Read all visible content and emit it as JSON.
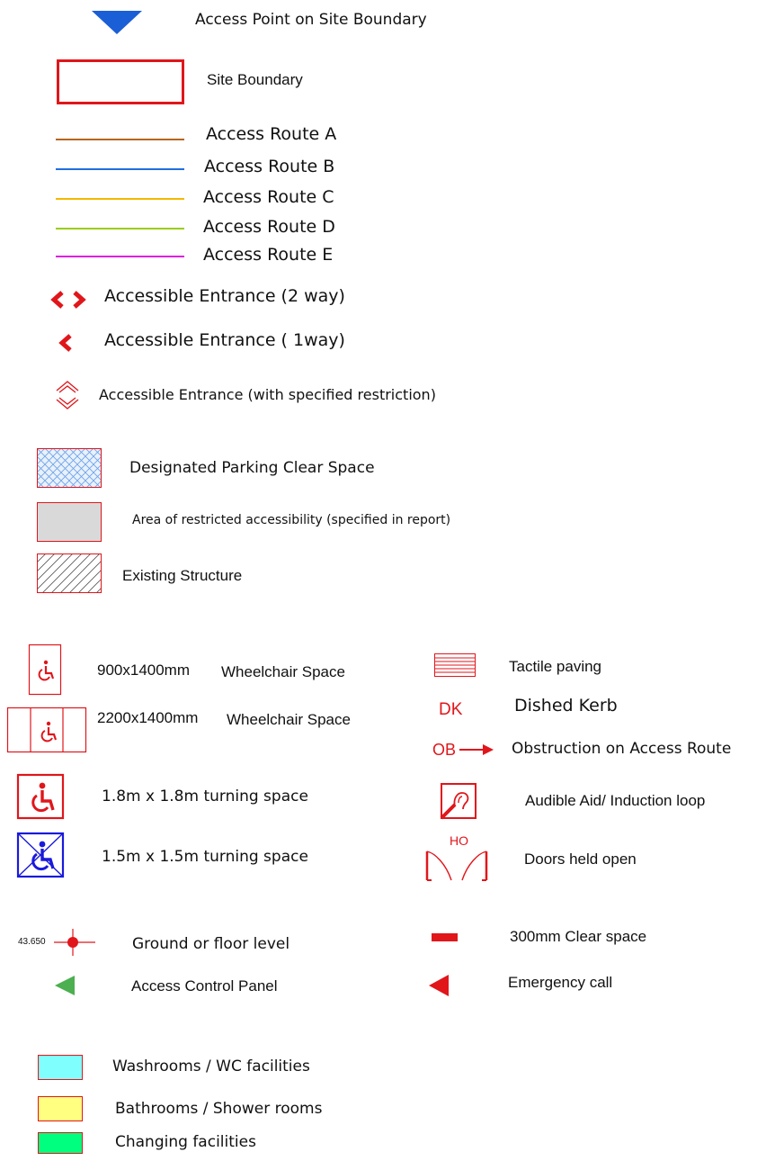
{
  "legend": {
    "access_point": "Access Point on Site Boundary",
    "site_boundary": "Site Boundary",
    "routes": [
      {
        "label": "Access Route A",
        "color": "#b5651d"
      },
      {
        "label": "Access Route B",
        "color": "#1f6fe0"
      },
      {
        "label": "Access Route C",
        "color": "#f5b800"
      },
      {
        "label": "Access Route D",
        "color": "#9acd1a"
      },
      {
        "label": "Access Route E",
        "color": "#e020e0"
      }
    ],
    "entrance_two_way": "Accessible Entrance (2 way)",
    "entrance_one_way": "Accessible Entrance ( 1way)",
    "entrance_restricted": "Accessible Entrance (with specified restriction)",
    "parking_clear_space": "Designated Parking Clear Space",
    "restricted_area": "Area of restricted accessibility (specified in report)",
    "existing_structure": "Existing Structure",
    "left_column": {
      "wheelchair_900_size": "900x1400mm",
      "wheelchair_900_label": "Wheelchair Space",
      "wheelchair_2200_size": "2200x1400mm",
      "wheelchair_2200_label": "Wheelchair Space",
      "turning_18": "1.8m x 1.8m turning space",
      "turning_15": "1.5m x 1.5m turning space",
      "level_value": "43.650",
      "level_label": "Ground or floor level",
      "access_control": "Access Control Panel"
    },
    "right_column": {
      "tactile_paving": "Tactile paving",
      "dk_code": "DK",
      "dished_kerb": "Dished Kerb",
      "ob_code": "OB",
      "obstruction": "Obstruction on Access Route",
      "audible_aid": "Audible Aid/ Induction loop",
      "ho_code": "HO",
      "doors_held": "Doors held open",
      "clear_space": "300mm Clear space",
      "emergency_call": "Emergency call"
    },
    "facilities": [
      {
        "label": "Washrooms / WC facilities",
        "color": "#80ffff"
      },
      {
        "label": "Bathrooms / Shower rooms",
        "color": "#ffff80"
      },
      {
        "label": "Changing facilities",
        "color": "#00ff7f"
      }
    ],
    "colors": {
      "red": "#e0161b",
      "blue": "#1a5fd6",
      "dark_blue": "#1a1adc",
      "green": "#4caf50",
      "grey_fill": "#d9d9d9"
    }
  }
}
